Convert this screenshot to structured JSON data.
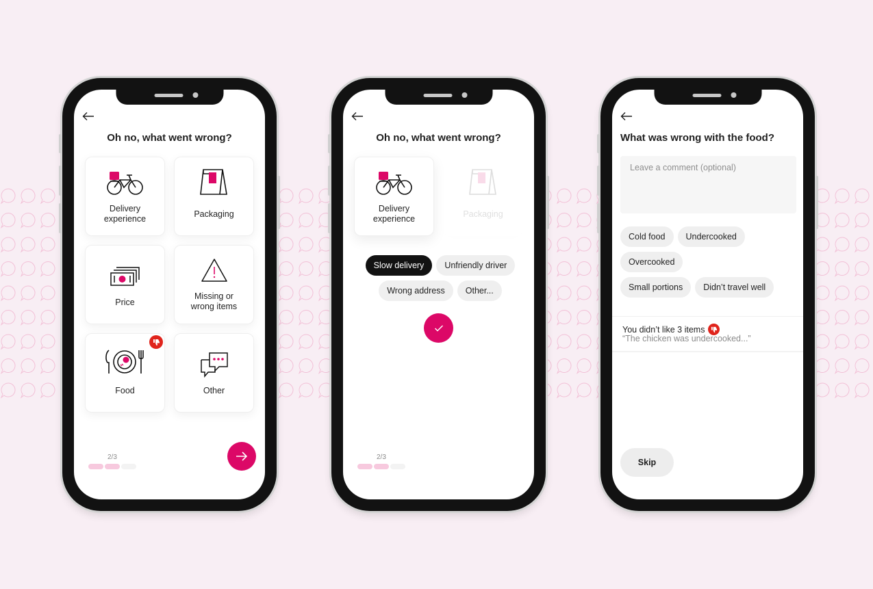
{
  "colors": {
    "accent": "#dc0867",
    "background": "#f8eef4",
    "selected_chip": "#121212",
    "badge": "#e0241c",
    "progress_on": "#f7c9de"
  },
  "screen1": {
    "title": "Oh no, what went wrong?",
    "back_icon": "arrow-left-icon",
    "categories": [
      {
        "label": "Delivery experience",
        "icon": "bicycle-icon"
      },
      {
        "label": "Packaging",
        "icon": "bag-icon"
      },
      {
        "label": "Price",
        "icon": "banknotes-icon"
      },
      {
        "label": "Missing or wrong items",
        "icon": "warning-icon"
      },
      {
        "label": "Food",
        "icon": "plate-icon",
        "badge": "thumbs-down-icon"
      },
      {
        "label": "Other",
        "icon": "chat-bubbles-icon"
      }
    ],
    "progress": {
      "label": "2/3",
      "current": 2,
      "total": 3
    },
    "next_icon": "arrow-right-icon"
  },
  "screen2": {
    "title": "Oh no, what went wrong?",
    "back_icon": "arrow-left-icon",
    "categories": [
      {
        "label": "Delivery experience",
        "icon": "bicycle-icon",
        "state": "selected"
      },
      {
        "label": "Packaging",
        "icon": "bag-icon",
        "state": "faded"
      }
    ],
    "chips": [
      {
        "label": "Slow delivery",
        "selected": true
      },
      {
        "label": "Unfriendly driver",
        "selected": false
      },
      {
        "label": "Wrong address",
        "selected": false
      },
      {
        "label": "Other...",
        "selected": false
      }
    ],
    "confirm_icon": "check-icon",
    "progress": {
      "label": "2/3",
      "current": 2,
      "total": 3
    }
  },
  "screen3": {
    "title": "What was wrong with the food?",
    "back_icon": "arrow-left-icon",
    "comment": {
      "placeholder": "Leave a comment (optional)",
      "value": ""
    },
    "chips": [
      {
        "label": "Cold food"
      },
      {
        "label": "Undercooked"
      },
      {
        "label": "Overcooked"
      },
      {
        "label": "Small portions"
      },
      {
        "label": "Didn’t travel well"
      }
    ],
    "summary": {
      "text": "You didn’t like 3 items",
      "quote": "“The chicken was undercooked...”",
      "icon": "thumbs-down-icon"
    },
    "skip_label": "Skip"
  }
}
